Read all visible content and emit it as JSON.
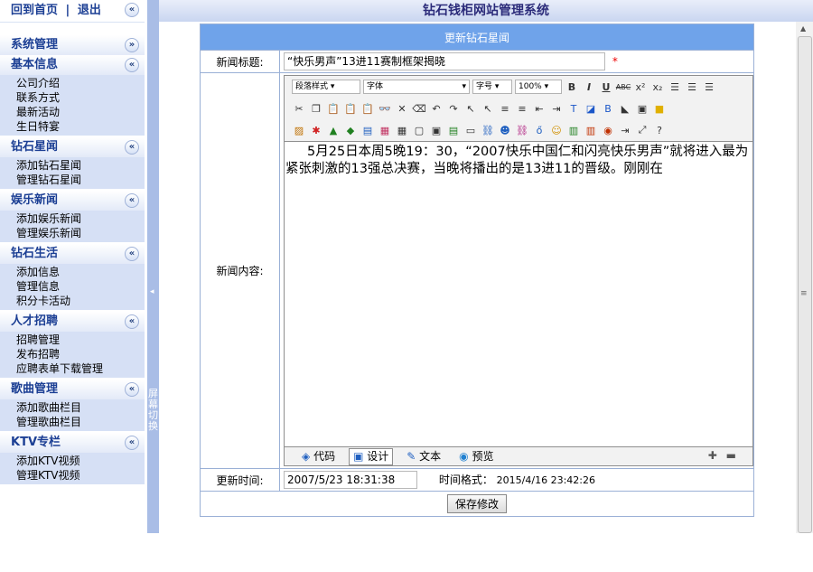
{
  "topnav": {
    "home": "回到首页",
    "sep": "|",
    "logout": "退出",
    "collapse_icon": "«"
  },
  "sidebar": {
    "groups": [
      {
        "title": "系统管理",
        "icon": "»",
        "items": []
      },
      {
        "title": "基本信息",
        "icon": "«",
        "items": [
          "公司介绍",
          "联系方式",
          "最新活动",
          "生日特宴"
        ]
      },
      {
        "title": "钻石星闻",
        "icon": "«",
        "items": [
          "添加钻石星闻",
          "管理钻石星闻"
        ]
      },
      {
        "title": "娱乐新闻",
        "icon": "«",
        "items": [
          "添加娱乐新闻",
          "管理娱乐新闻"
        ]
      },
      {
        "title": "钻石生活",
        "icon": "«",
        "items": [
          "添加信息",
          "管理信息",
          "积分卡活动"
        ]
      },
      {
        "title": "人才招聘",
        "icon": "«",
        "items": [
          "招聘管理",
          "发布招聘",
          "应聘表单下载管理"
        ]
      },
      {
        "title": "歌曲管理",
        "icon": "«",
        "items": [
          "添加歌曲栏目",
          "管理歌曲栏目"
        ]
      },
      {
        "title": "KTV专栏",
        "icon": "«",
        "items": [
          "添加KTV视频",
          "管理KTV视频"
        ]
      }
    ]
  },
  "splitter": {
    "arrow": "◂",
    "text": "屏幕切换"
  },
  "app_title": "钻石钱柜网站管理系统",
  "form": {
    "heading": "更新钻石星闻",
    "title_label": "新闻标题:",
    "title_value": "“快乐男声”13进11赛制框架揭晓",
    "required_mark": "*",
    "content_label": "新闻内容:",
    "time_label": "更新时间:",
    "time_value": "2007/5/23 18:31:38",
    "time_format_label": "时间格式：",
    "time_format_example": "2015/4/16 23:42:26",
    "save_label": "保存修改"
  },
  "editor": {
    "style_select": "段落样式",
    "font_select": "字体",
    "size_select": "字号",
    "zoom_select": "100%",
    "content": "5月25日本周5晚19：30，“2007快乐中国仁和闪亮快乐男声”就将进入最为紧张刺激的13强总决赛，当晚将播出的是13进11的晋级。刚刚在",
    "modes": [
      {
        "label": "代码",
        "icon": "code-icon"
      },
      {
        "label": "设计",
        "icon": "design-icon"
      },
      {
        "label": "文本",
        "icon": "text-icon"
      },
      {
        "label": "预览",
        "icon": "preview-icon"
      }
    ],
    "expand_icon": "✚",
    "shrink_icon": "▬"
  }
}
